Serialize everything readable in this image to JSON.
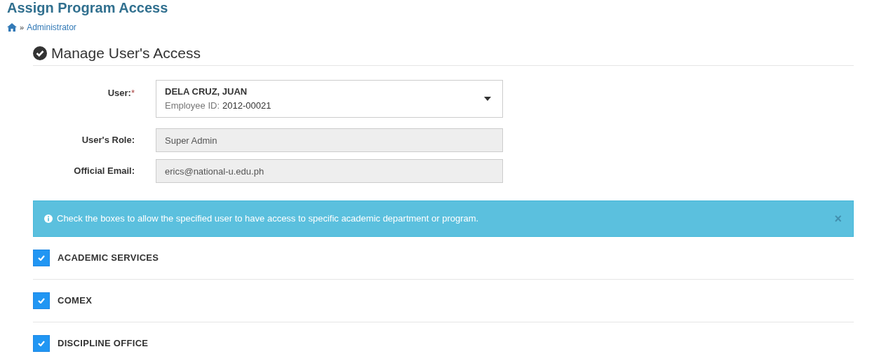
{
  "page_title": "Assign Program Access",
  "breadcrumb": {
    "separator": "»",
    "items": [
      "Administrator"
    ]
  },
  "section": {
    "title": "Manage User's Access"
  },
  "user_field": {
    "label": "User:",
    "required_mark": "*",
    "name": "DELA CRUZ, JUAN",
    "id_label": "Employee ID:",
    "id_value": "2012-00021"
  },
  "readonly_fields": [
    {
      "label": "User's Role:",
      "value": "Super Admin"
    },
    {
      "label": "Official Email:",
      "value": "erics@national-u.edu.ph"
    }
  ],
  "alert": {
    "message": "Check the boxes to allow the specified user to have access to specific academic department or program.",
    "close": "×"
  },
  "programs": [
    {
      "name": "ACADEMIC SERVICES",
      "checked": true
    },
    {
      "name": "COMEX",
      "checked": true
    },
    {
      "name": "DISCIPLINE OFFICE",
      "checked": true
    }
  ]
}
